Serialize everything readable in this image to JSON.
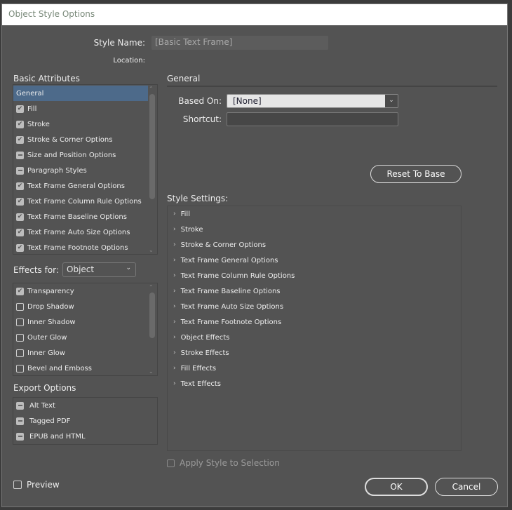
{
  "window": {
    "title": "Object Style Options"
  },
  "style_name": {
    "label": "Style Name:",
    "value": "[Basic Text Frame]"
  },
  "location": {
    "label": "Location:"
  },
  "basic_attributes": {
    "title": "Basic Attributes",
    "items": [
      {
        "label": "General",
        "state": "selected"
      },
      {
        "label": "Fill",
        "state": "checked"
      },
      {
        "label": "Stroke",
        "state": "checked"
      },
      {
        "label": "Stroke & Corner Options",
        "state": "checked"
      },
      {
        "label": "Size and Position Options",
        "state": "partial"
      },
      {
        "label": "Paragraph Styles",
        "state": "partial"
      },
      {
        "label": "Text Frame General Options",
        "state": "checked"
      },
      {
        "label": "Text Frame Column Rule Options",
        "state": "checked"
      },
      {
        "label": "Text Frame Baseline Options",
        "state": "checked"
      },
      {
        "label": "Text Frame Auto Size Options",
        "state": "checked"
      },
      {
        "label": "Text Frame Footnote Options",
        "state": "checked"
      }
    ]
  },
  "effects": {
    "label": "Effects for:",
    "selected": "Object",
    "items": [
      {
        "label": "Transparency",
        "state": "checked"
      },
      {
        "label": "Drop Shadow",
        "state": "unchecked"
      },
      {
        "label": "Inner Shadow",
        "state": "unchecked"
      },
      {
        "label": "Outer Glow",
        "state": "unchecked"
      },
      {
        "label": "Inner Glow",
        "state": "unchecked"
      },
      {
        "label": "Bevel and Emboss",
        "state": "unchecked"
      }
    ]
  },
  "export": {
    "title": "Export Options",
    "items": [
      {
        "label": "Alt Text",
        "state": "partial"
      },
      {
        "label": "Tagged PDF",
        "state": "partial"
      },
      {
        "label": "EPUB and HTML",
        "state": "partial"
      }
    ]
  },
  "general": {
    "title": "General",
    "based_on_label": "Based On:",
    "based_on_value": "[None]",
    "shortcut_label": "Shortcut:",
    "shortcut_value": "",
    "reset_label": "Reset To Base"
  },
  "style_settings": {
    "title": "Style Settings:",
    "items": [
      "Fill",
      "Stroke",
      "Stroke & Corner Options",
      "Text Frame General Options",
      "Text Frame Column Rule Options",
      "Text Frame Baseline Options",
      "Text Frame Auto Size Options",
      "Text Frame Footnote Options",
      "Object Effects",
      "Stroke Effects",
      "Fill Effects",
      "Text Effects"
    ]
  },
  "apply_style": {
    "label": "Apply Style to Selection",
    "checked": false,
    "disabled": true
  },
  "preview": {
    "label": "Preview",
    "checked": false
  },
  "buttons": {
    "ok": "OK",
    "cancel": "Cancel"
  }
}
